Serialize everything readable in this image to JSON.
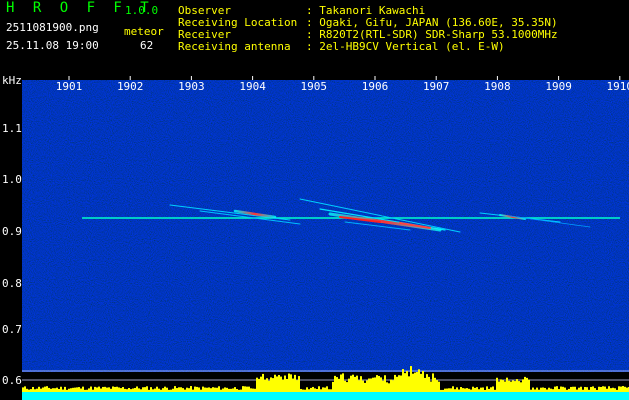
{
  "header": {
    "app_title": "H R O F F T",
    "version": "1.0.0",
    "file_name": "2511081900.png",
    "datetime": "25.11.08 19:00",
    "meteor_label": "meteor",
    "meteor_count": "62"
  },
  "metadata": [
    {
      "key": "Observer",
      "value": ": Takanori Kawachi"
    },
    {
      "key": "Receiving Location",
      "value": ": Ogaki, Gifu, JAPAN (136.60E, 35.35N)"
    },
    {
      "key": "Receiver",
      "value": ": R820T2(RTL-SDR) SDR-Sharp 53.1000MHz"
    },
    {
      "key": "Receiving antenna",
      "value": ": 2el-HB9CV Vertical (el. E-W)"
    }
  ],
  "axes": {
    "freq_unit": "kHz",
    "freq_ticks": [
      "1.1",
      "1.0",
      "0.9",
      "0.8",
      "0.7",
      "0.6"
    ],
    "freq_ticks_bottom": [
      "0.6"
    ],
    "time_ticks": [
      "1901",
      "1902",
      "1903",
      "1904",
      "1905",
      "1906",
      "1907",
      "1908",
      "1909",
      "1910"
    ]
  },
  "colors": {
    "background": "#000000",
    "noise_dark": "#00008c",
    "carrier": "#00ffcc",
    "power_bar": "#ffff00",
    "baseline": "#00ffff",
    "tick_text": "#ffffff"
  }
}
